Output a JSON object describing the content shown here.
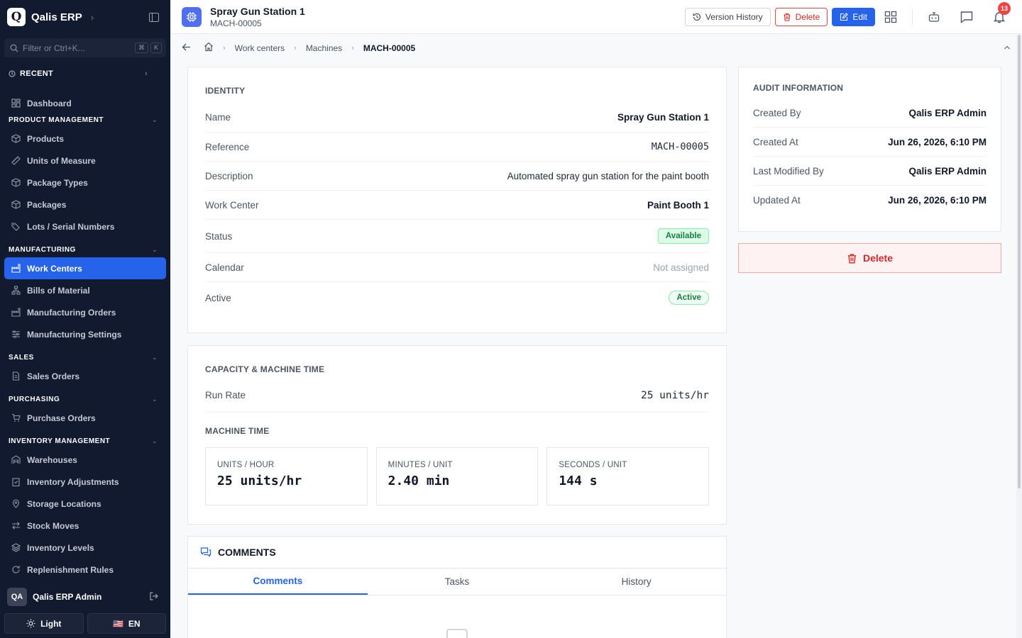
{
  "brand": {
    "logo_letter": "Q",
    "name": "Qalis ERP"
  },
  "search": {
    "placeholder": "Filter or Ctrl+K...",
    "key1": "⌘",
    "key2": "K"
  },
  "recent_label": "RECENT",
  "nav": {
    "dashboard": "Dashboard",
    "product_management": {
      "title": "PRODUCT MANAGEMENT",
      "items": [
        "Products",
        "Units of Measure",
        "Package Types",
        "Packages",
        "Lots / Serial Numbers"
      ]
    },
    "manufacturing": {
      "title": "MANUFACTURING",
      "items": [
        "Work Centers",
        "Bills of Material",
        "Manufacturing Orders",
        "Manufacturing Settings"
      ]
    },
    "sales": {
      "title": "SALES",
      "items": [
        "Sales Orders"
      ]
    },
    "purchasing": {
      "title": "PURCHASING",
      "items": [
        "Purchase Orders"
      ]
    },
    "inventory": {
      "title": "INVENTORY MANAGEMENT",
      "items": [
        "Warehouses",
        "Inventory Adjustments",
        "Storage Locations",
        "Stock Moves",
        "Inventory Levels",
        "Replenishment Rules"
      ]
    }
  },
  "user": {
    "initials": "QA",
    "name": "Qalis ERP Admin"
  },
  "footer": {
    "theme_label": "Light",
    "lang_label": "EN",
    "flag": "🇺🇸"
  },
  "header": {
    "title": "Spray Gun Station 1",
    "subtitle": "MACH-00005",
    "version_history": "Version History",
    "delete": "Delete",
    "edit": "Edit",
    "notifications": "13"
  },
  "breadcrumb": {
    "items": [
      "Work centers",
      "Machines"
    ],
    "current": "MACH-00005"
  },
  "identity": {
    "title": "IDENTITY",
    "name_label": "Name",
    "name_value": "Spray Gun Station 1",
    "reference_label": "Reference",
    "reference_value": "MACH-00005",
    "description_label": "Description",
    "description_value": "Automated spray gun station for the paint booth",
    "workcenter_label": "Work Center",
    "workcenter_value": "Paint Booth 1",
    "status_label": "Status",
    "status_value": "Available",
    "calendar_label": "Calendar",
    "calendar_value": "Not assigned",
    "active_label": "Active",
    "active_value": "Active"
  },
  "capacity": {
    "title": "CAPACITY & MACHINE TIME",
    "run_rate_label": "Run Rate",
    "run_rate_value": "25 units/hr",
    "machine_time_title": "MACHINE TIME",
    "metrics": [
      {
        "label": "UNITS / HOUR",
        "value": "25 units/hr"
      },
      {
        "label": "MINUTES / UNIT",
        "value": "2.40 min"
      },
      {
        "label": "SECONDS / UNIT",
        "value": "144 s"
      }
    ]
  },
  "comments": {
    "title": "COMMENTS",
    "tabs": [
      "Comments",
      "Tasks",
      "History"
    ]
  },
  "audit": {
    "title": "AUDIT INFORMATION",
    "created_by_label": "Created By",
    "created_by_value": "Qalis ERP Admin",
    "created_at_label": "Created At",
    "created_at_value": "Jun 26, 2026, 6:10 PM",
    "modified_by_label": "Last Modified By",
    "modified_by_value": "Qalis ERP Admin",
    "updated_at_label": "Updated At",
    "updated_at_value": "Jun 26, 2026, 6:10 PM"
  },
  "delete_panel_label": "Delete",
  "colors": {
    "accent": "#2563eb",
    "sidebar_bg": "#111a2e",
    "danger": "#dc2626",
    "success": "#15803d"
  }
}
